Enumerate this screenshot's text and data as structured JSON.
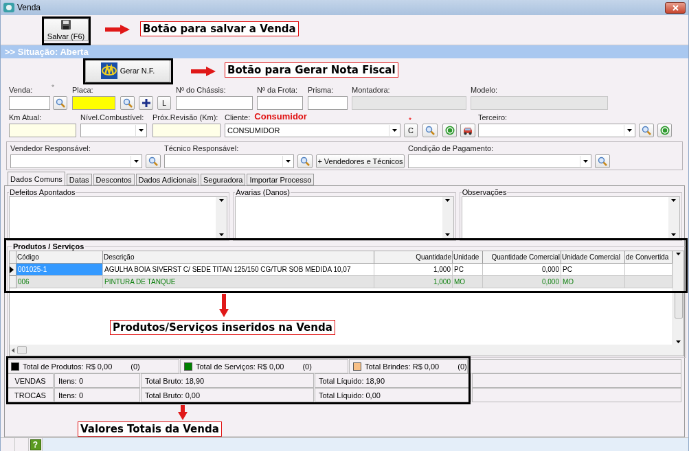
{
  "window": {
    "title": "Venda"
  },
  "toolbar": {
    "save_button": "Salvar (F6)"
  },
  "situation": ">> Situação: Aberta",
  "invoice_button": "Gerar N.F.",
  "form_rows": [
    [
      {
        "kind": "input",
        "label": "Venda:",
        "mark": "*"
      },
      {
        "kind": "search"
      },
      {
        "kind": "input",
        "label": "Placa:",
        "color": "#ffff00"
      },
      {
        "kind": "search"
      },
      {
        "kind": "plus"
      },
      {
        "kind": "letter",
        "text": "L"
      },
      {
        "kind": "input",
        "label": "Nº do Chássis:"
      },
      {
        "kind": "input",
        "label": "Nº da Frota:"
      },
      {
        "kind": "input",
        "label": "Prisma:"
      },
      {
        "kind": "input",
        "label": "Montadora:",
        "disabled": true
      },
      {
        "kind": "input",
        "label": "Modelo:",
        "disabled": true
      }
    ],
    [
      {
        "kind": "input",
        "label": "Km Atual:",
        "color": "#ffffe8"
      },
      {
        "kind": "combo",
        "label": "Nível.Combustível:"
      },
      {
        "kind": "input",
        "label": "Próx.Revisão (Km):",
        "color": "#ffffe8"
      },
      {
        "kind": "combo",
        "label": "Cliente:",
        "note": "Consumidor",
        "value": "CONSUMIDOR"
      },
      {
        "kind": "letter",
        "text": "C",
        "mark": "*"
      },
      {
        "kind": "search"
      },
      {
        "kind": "money"
      },
      {
        "kind": "car"
      },
      {
        "kind": "combo",
        "label": "Terceiro:"
      },
      {
        "kind": "search"
      },
      {
        "kind": "money"
      }
    ],
    [
      {
        "kind": "combo",
        "label": "Vendedor Responsável:"
      },
      {
        "kind": "search"
      },
      {
        "kind": "combo",
        "label": "Técnico Responsável:"
      },
      {
        "kind": "search"
      },
      {
        "kind": "wide",
        "text": "+ Vendedores e Técnicos"
      },
      {
        "kind": "combo",
        "label": "Condição de Pagamento:"
      },
      {
        "kind": "search"
      }
    ]
  ],
  "tabs": [
    {
      "label": "Dados Comuns",
      "selected": true
    },
    {
      "label": "Datas",
      "selected": false
    },
    {
      "label": "Descontos",
      "selected": false
    },
    {
      "label": "Dados Adicionais",
      "selected": false
    },
    {
      "label": "Seguradora",
      "selected": false
    },
    {
      "label": "Importar Processo",
      "selected": false
    }
  ],
  "notes": [
    {
      "label": "Defeitos Apontados"
    },
    {
      "label": "Avarias (Danos)"
    },
    {
      "label": "Observações"
    }
  ],
  "items": {
    "title": "Produtos / Serviços",
    "columns": [
      "Código",
      "Descrição",
      "Quantidade",
      "Unidade",
      "Quantidade Comercial",
      "Unidade Comercial",
      "de Convertida"
    ],
    "rows": [
      {
        "kind": "product",
        "selected": true,
        "cells": [
          "001025-1",
          "AGULHA BOIA SIVERST C/ SEDE TITAN 125/150 CG/TUR SOB MEDIDA 10,07",
          "1,000",
          "PC",
          "0,000",
          "PC",
          ""
        ]
      },
      {
        "kind": "service",
        "selected": false,
        "cells": [
          "006",
          "PINTURA DE TANQUE",
          "1,000",
          "MO",
          "0,000",
          "MO",
          ""
        ]
      }
    ]
  },
  "totals": {
    "legend": [
      {
        "text": "Total de Produtos: R$  0,00",
        "count": "(0)",
        "color": "#000000"
      },
      {
        "text": "Total de Serviços: R$  0,00",
        "count": "(0)",
        "color": "#008000"
      },
      {
        "text": "Total Brindes: R$  0,00",
        "count": "(0)",
        "color": "#f8c088"
      }
    ],
    "rows": [
      [
        "VENDAS",
        "Itens: 0",
        "Total Bruto: 18,90",
        "Total Líquido: 18,90"
      ],
      [
        "TROCAS",
        "Itens: 0",
        "Total Bruto: 0,00",
        "Total Líquido: 0,00"
      ]
    ]
  },
  "status_bar": {
    "help": "?"
  },
  "annotations": [
    {
      "text": "Botão para salvar a Venda"
    },
    {
      "text": "Botão para Gerar Nota  Fiscal"
    },
    {
      "text": "Produtos/Serviços inseridos na Venda"
    },
    {
      "text": "Valores Totais da Venda"
    }
  ]
}
